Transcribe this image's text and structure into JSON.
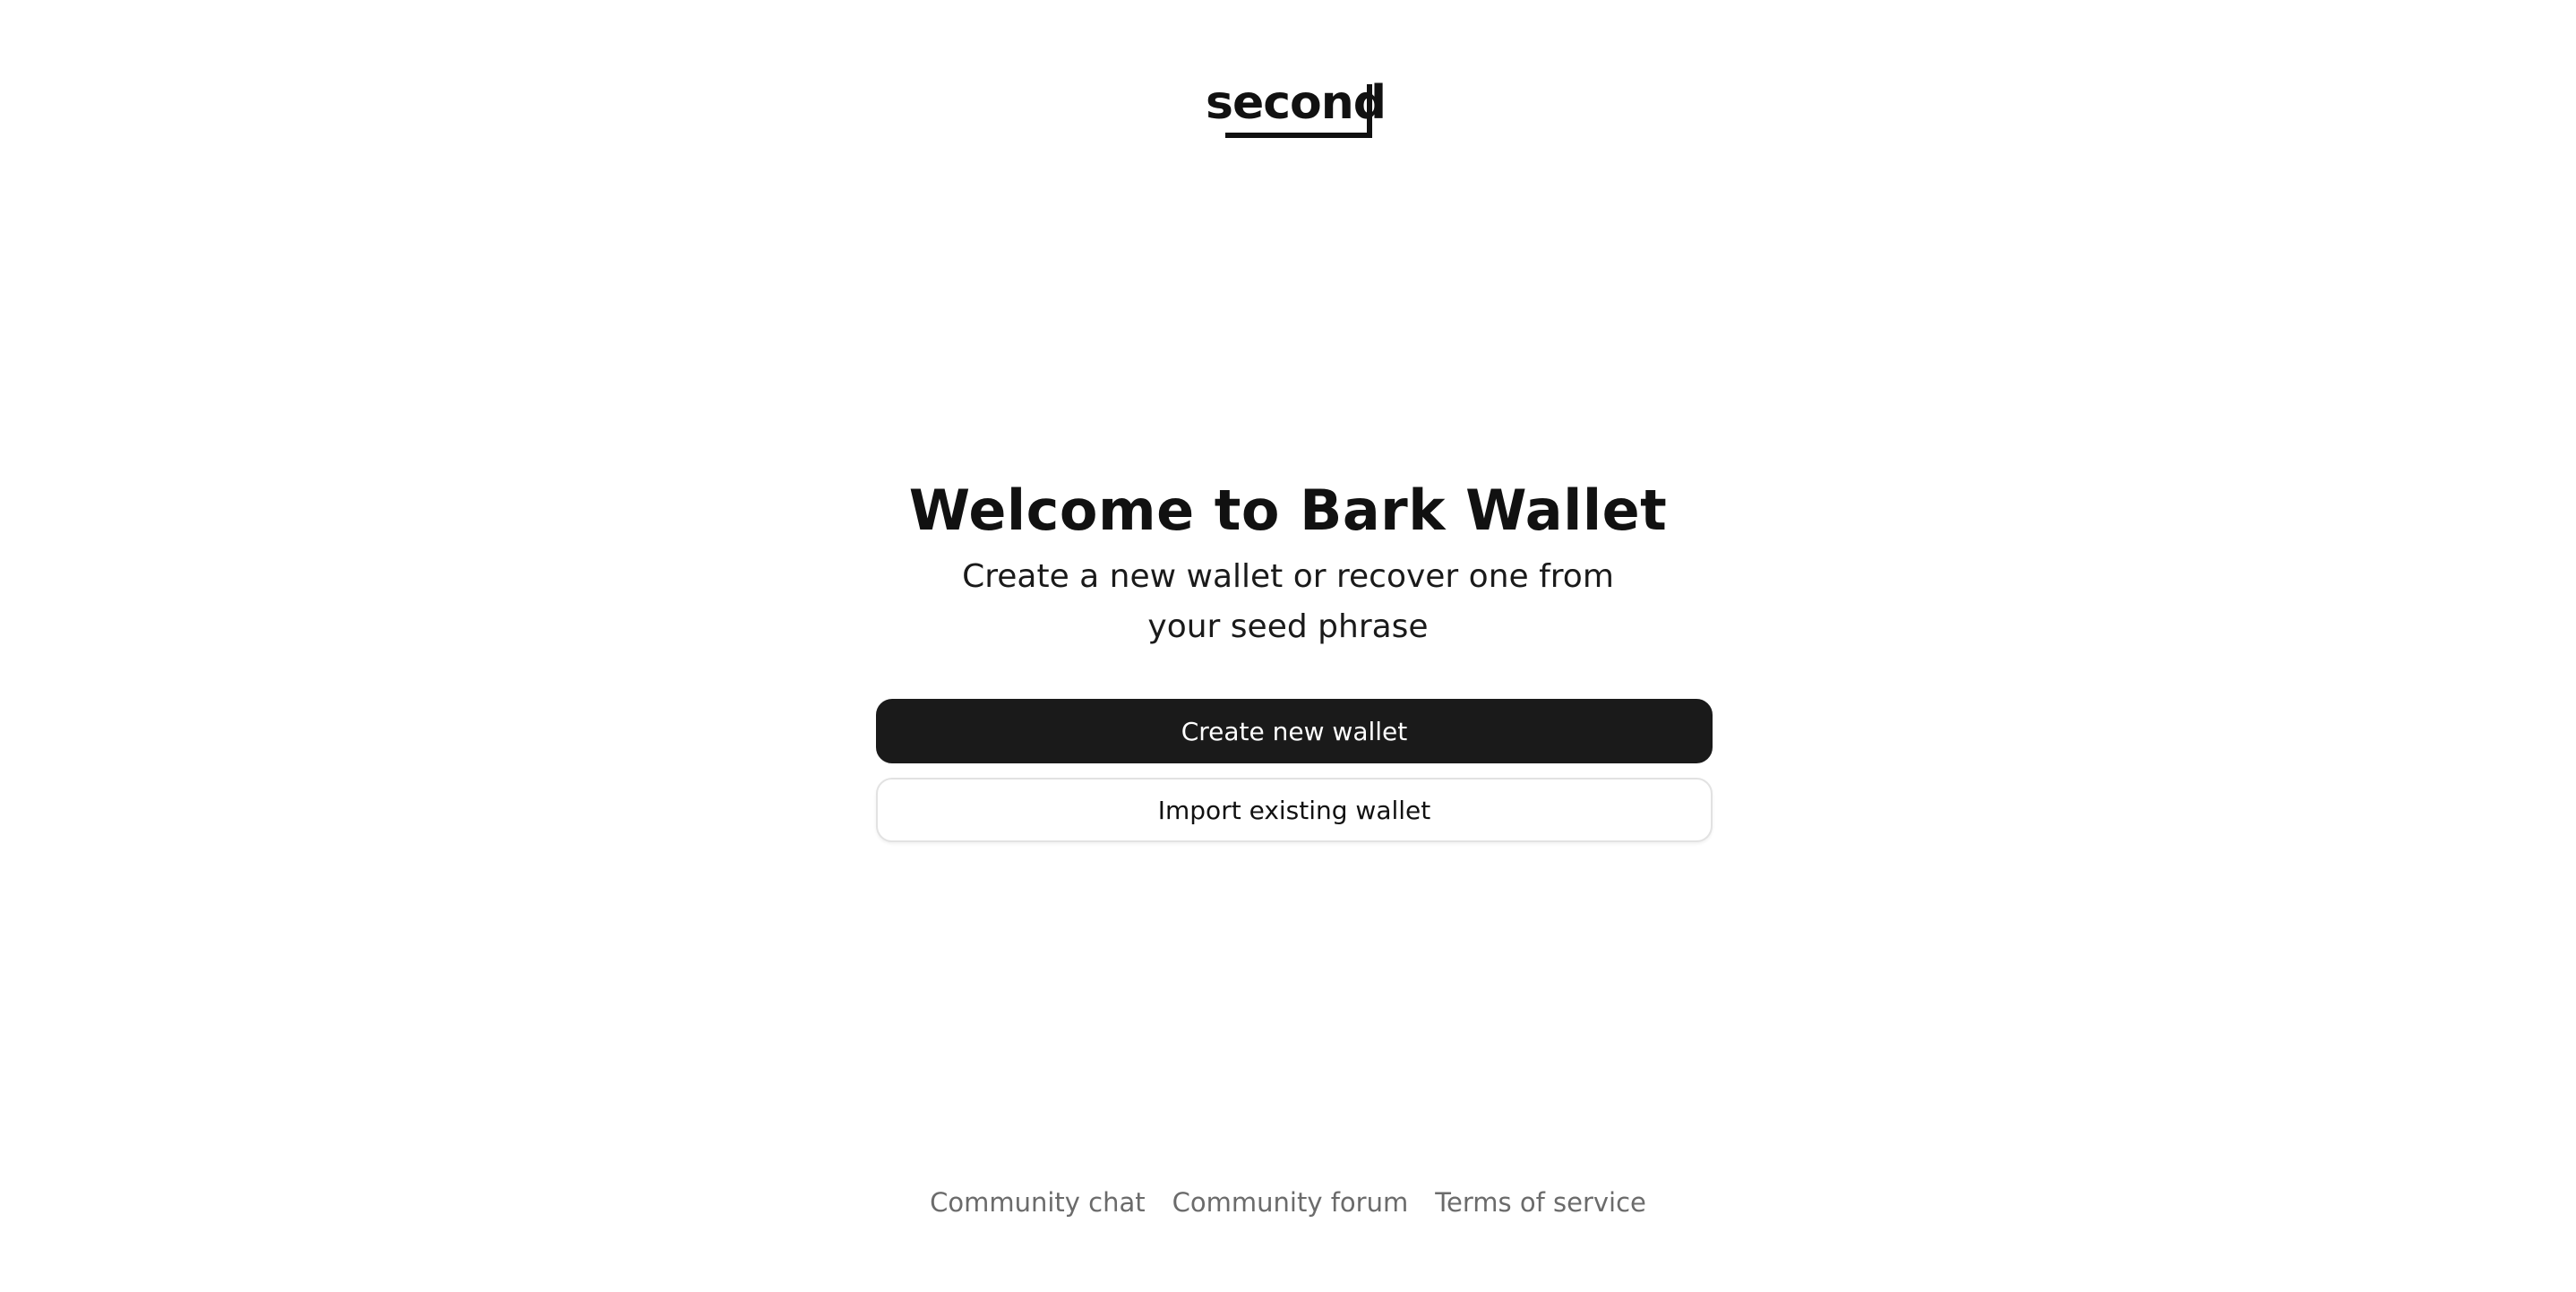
{
  "logo": {
    "text": "second"
  },
  "hero": {
    "title": "Welcome to Bark Wallet",
    "subtitle": "Create a new wallet or recover one from your seed phrase"
  },
  "actions": {
    "create_label": "Create new wallet",
    "import_label": "Import existing wallet"
  },
  "footer": {
    "links": [
      "Community chat",
      "Community forum",
      "Terms of service"
    ]
  },
  "colors": {
    "background": "#ffffff",
    "primary_button": "#1a1a1a",
    "primary_text": "#ffffff",
    "footer_link": "#6b6b6b"
  }
}
